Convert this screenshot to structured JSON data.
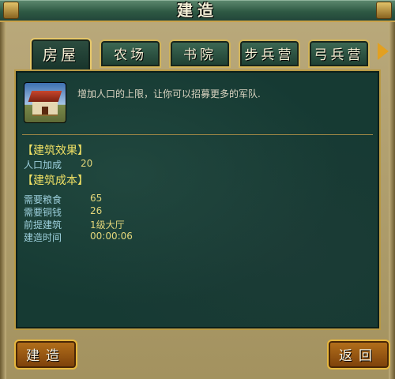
{
  "window": {
    "title": "建造"
  },
  "tabs": [
    {
      "label": "房屋",
      "active": true
    },
    {
      "label": "农场",
      "active": false
    },
    {
      "label": "书院",
      "active": false
    },
    {
      "label": "步兵营",
      "active": false
    },
    {
      "label": "弓兵营",
      "active": false
    }
  ],
  "building": {
    "icon": "house-building-icon",
    "description": "增加人口的上限，让你可以招募更多的军队."
  },
  "effect": {
    "heading": "【建筑效果】",
    "rows": [
      {
        "label": "人口加成",
        "value": "20"
      }
    ]
  },
  "cost": {
    "heading": "【建筑成本】",
    "rows": [
      {
        "label": "需要粮食",
        "value": "65"
      },
      {
        "label": "需要铜钱",
        "value": "26"
      },
      {
        "label": "前提建筑",
        "value": "1级大厅"
      },
      {
        "label": "建造时间",
        "value": "00:00:06"
      }
    ]
  },
  "buttons": {
    "build": "建造",
    "back": "返回"
  },
  "colors": {
    "accent": "#e2a021",
    "panel": "#163a33",
    "label": "#9dd0dd",
    "value": "#e3d67a",
    "heading": "#efe064"
  }
}
